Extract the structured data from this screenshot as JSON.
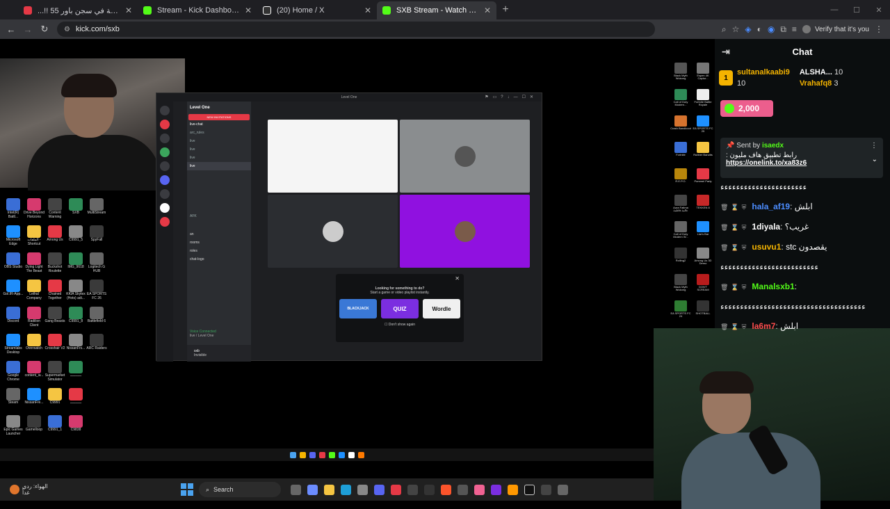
{
  "browser": {
    "tabs": [
      {
        "title": "...!! ساعة في سجن باور 55",
        "color": "#e53946",
        "active": false
      },
      {
        "title": "Stream - Kick Dashboard",
        "color": "#53fc18",
        "active": false
      },
      {
        "title": "(20) Home / X",
        "color": "#ffffff",
        "active": false
      },
      {
        "title": "SXB Stream - Watch Live on Kick",
        "color": "#53fc18",
        "active": true
      }
    ],
    "new_tab": "+",
    "url": "kick.com/sxb",
    "verify_label": "Verify that it's you"
  },
  "discord": {
    "window_title": "Level One",
    "server_name": "Level One",
    "new_invitations": "NEW INVITATIONS",
    "channels": [
      "live-chat",
      "arc_rules",
      "live",
      "live",
      "live",
      "live"
    ],
    "sub_channels": [
      "an",
      "rooms",
      "roles",
      "chat-logo"
    ],
    "afk": "AFK",
    "voice_status": "Voice Connected",
    "voice_sub": "live / Level One",
    "user_name": "sxb",
    "user_status": "Invisible",
    "activity_prompt": "Looking for something to do?",
    "activity_sub": "Start a game or video playlist instantly.",
    "games": [
      "BLACKJACK",
      "QUIZ",
      "Wordle"
    ],
    "dont_show": "Don't show again"
  },
  "desktop_left": [
    "Intel(R) Battl...",
    "Drive Beyond Horizons",
    "Content Warning",
    "SXB",
    "MultiStream",
    "Microsoft Edge",
    "الملفات - Shortcut",
    "Among Us",
    "C9991_5",
    "SpyFall",
    "OBS Studio",
    "Dying Light The Beast",
    "Buckshot Roulette",
    "IMG_9618",
    "Logitech G HUB",
    "Gol.IR-App...",
    "Lethal Company",
    "Chained Together",
    "KKIA Skytex (Hots) adi...",
    "EA SPORTS FC 26",
    "Discord",
    "Radilion Client",
    "Gang Beasts",
    "C9991_8",
    "Battlefield 6",
    "Streamlabs Desktop",
    "Overwatch",
    "Crosshair V2",
    "NissanFrs...",
    "ARC Raiders",
    "Google Chrome",
    "content_w...",
    "Supermarket Simulator",
    "ـــــــــــ",
    "Steam",
    "NissanFre...",
    "C9991",
    "ـــــــــــ",
    "Epic Games Launcher",
    "Gamelloop",
    "C9991_1",
    "C9838"
  ],
  "desktop_right": [
    "Black Myth Wukong",
    "Espen 4K Captur...",
    "Call of Duty Modern...",
    "Fortnite Battle Royale",
    "Crash Bandicoot",
    "EA SPORTS FC 25",
    "Fortnite",
    "Rubber Bandits",
    "R.E.P.O.",
    "Pummel Party",
    "Aura Fatima عالمة فاطمة",
    "TEKKEN 8",
    "Call of Duty Modern W...",
    "Liar's Bar",
    "Rolling2",
    "Among Us 3D Demo",
    "Black Myth Wukong",
    "DON'T SCREAM",
    "EA SPORTS FC 24",
    "SHOTBALL"
  ],
  "taskbar": {
    "weather_line1": "الهواء: ردي",
    "weather_line2": "غداً",
    "search_label": "Search"
  },
  "chat": {
    "header": "Chat",
    "gifters": [
      {
        "rank": "1",
        "name": "sultanalkaabi9",
        "count": "10"
      },
      {
        "rank": "2",
        "name": "ALSHA...",
        "count": "10"
      },
      {
        "rank": "3",
        "name": "Vrahafq8",
        "count": "3"
      }
    ],
    "kicks_amount": "2,000",
    "pinned_sent_by": "Sent by",
    "pinned_user": "isaedx",
    "pinned_text": "رابط تطبيق هاف مليون :",
    "pinned_link": "https://onelink.to/xa83z6",
    "messages": [
      {
        "user": "",
        "text": "ءءءءءءءءءءءءءءءءءءءءءء",
        "color": "#ffffff"
      },
      {
        "user": "hala_af19",
        "text": "ابلش",
        "color": "#4c8dff"
      },
      {
        "user": "1diyala",
        "text": "غريب؟",
        "color": "#ffffff"
      },
      {
        "user": "usuvu1",
        "text": "stc يقصدون",
        "color": "#f5b400"
      },
      {
        "user": "",
        "text": "ءءءءءءءءءءءءءءءءءءءءءءءءء",
        "color": "#ffffff"
      },
      {
        "user": "Manalsxb1",
        "text": "",
        "color": "#53fc18"
      },
      {
        "user": "",
        "text": "ءءءءءءءءءءءءءءءءءءءءءءءءءءءءءءءءءءءءء",
        "color": "#ffffff"
      },
      {
        "user": "la6m7",
        "text": "ابلش",
        "color": "#ff4d4d"
      }
    ]
  },
  "colors": {
    "kick_green": "#53fc18",
    "discord_purple": "#9011e0",
    "alert_red": "#e53946"
  }
}
